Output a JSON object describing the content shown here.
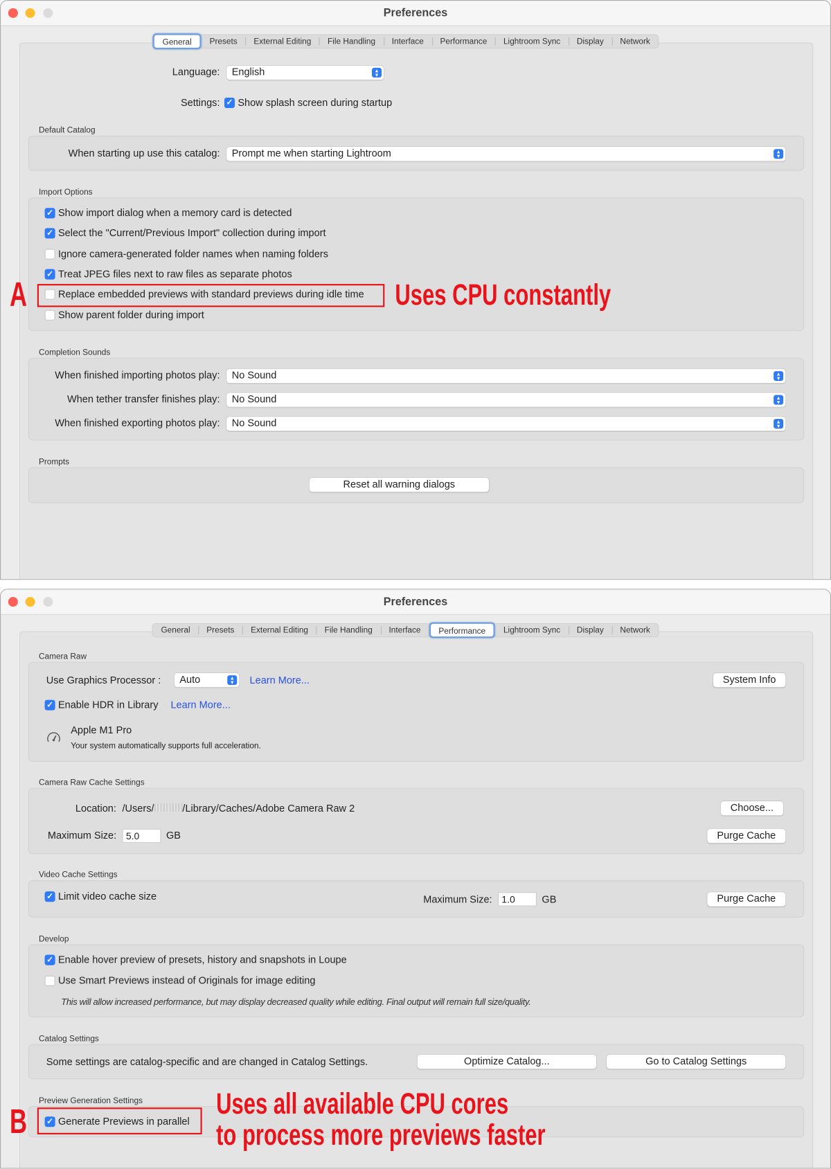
{
  "tabs": [
    "General",
    "Presets",
    "External Editing",
    "File Handling",
    "Interface",
    "Performance",
    "Lightroom Sync",
    "Display",
    "Network"
  ],
  "general": {
    "title": "Preferences",
    "language_label": "Language:",
    "language_value": "English",
    "settings_label": "Settings:",
    "splash_label": "Show splash screen during startup",
    "default_catalog": {
      "header": "Default Catalog",
      "label": "When starting up use this catalog:",
      "value": "Prompt me when starting Lightroom"
    },
    "import_options": {
      "header": "Import Options",
      "items": [
        {
          "label": "Show import dialog when a memory card is detected",
          "checked": true
        },
        {
          "label": "Select the \"Current/Previous Import\" collection during import",
          "checked": true
        },
        {
          "label": "Ignore camera-generated folder names when naming folders",
          "checked": false
        },
        {
          "label": "Treat JPEG files next to raw files as separate photos",
          "checked": true
        },
        {
          "label": "Replace embedded previews with standard previews during idle time",
          "checked": false
        },
        {
          "label": "Show parent folder during import",
          "checked": false
        }
      ]
    },
    "completion_sounds": {
      "header": "Completion Sounds",
      "rows": [
        {
          "label": "When finished importing photos play:",
          "value": "No Sound"
        },
        {
          "label": "When tether transfer finishes play:",
          "value": "No Sound"
        },
        {
          "label": "When finished exporting photos play:",
          "value": "No Sound"
        }
      ]
    },
    "prompts": {
      "header": "Prompts",
      "button": "Reset all warning dialogs"
    }
  },
  "performance": {
    "title": "Preferences",
    "camera_raw": {
      "header": "Camera Raw",
      "gpu_label": "Use Graphics Processor :",
      "gpu_value": "Auto",
      "learn_more": "Learn More...",
      "system_info": "System Info",
      "hdr_label": "Enable HDR in Library",
      "hdr_learn_more": "Learn More...",
      "gpu_name": "Apple M1 Pro",
      "gpu_note": "Your system automatically supports full acceleration."
    },
    "cache": {
      "header": "Camera Raw Cache Settings",
      "location_label": "Location:",
      "location_prefix": "/Users/",
      "location_suffix": "/Library/Caches/Adobe Camera Raw 2",
      "choose": "Choose...",
      "max_label": "Maximum Size:",
      "max_value": "5.0",
      "unit": "GB",
      "purge": "Purge Cache"
    },
    "video": {
      "header": "Video Cache Settings",
      "limit_label": "Limit video cache size",
      "max_label": "Maximum Size:",
      "max_value": "1.0",
      "unit": "GB",
      "purge": "Purge Cache"
    },
    "develop": {
      "header": "Develop",
      "hover_label": "Enable hover preview of presets, history and snapshots in Loupe",
      "smart_label": "Use Smart Previews instead of Originals for image editing",
      "note": "This will allow increased performance, but may display decreased quality while editing. Final output will remain full size/quality."
    },
    "catalog": {
      "header": "Catalog Settings",
      "text": "Some settings are catalog-specific and are changed in Catalog Settings.",
      "optimize": "Optimize Catalog...",
      "goto": "Go to Catalog Settings"
    },
    "preview": {
      "header": "Preview Generation Settings",
      "parallel_label": "Generate Previews in parallel"
    }
  },
  "annotations": {
    "a_letter": "A",
    "a_text": "Uses CPU constantly",
    "b_letter": "B",
    "b_line1": "Uses all available CPU cores",
    "b_line2": "to process more previews faster",
    "color": "#e8141b"
  }
}
